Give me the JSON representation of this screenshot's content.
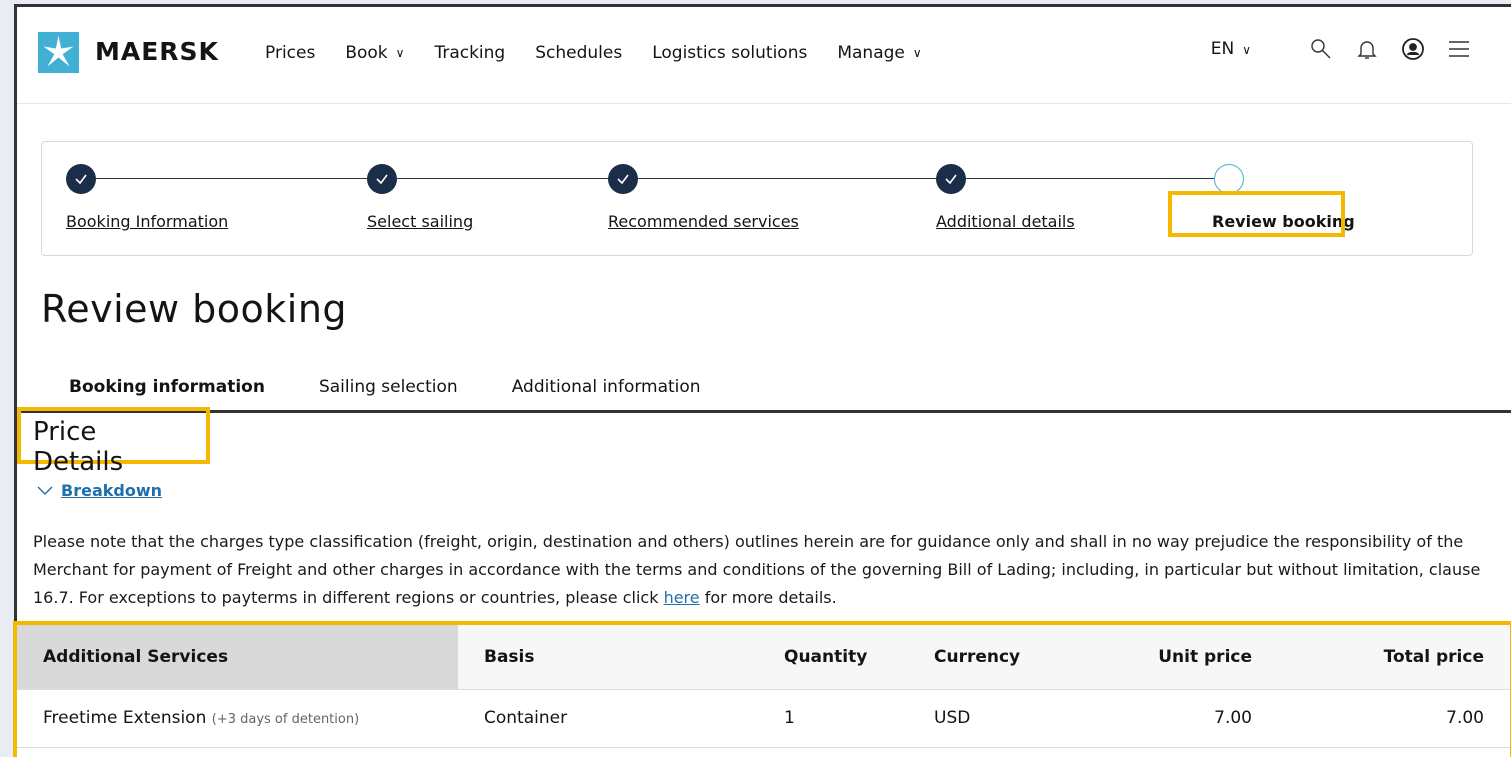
{
  "header": {
    "brand": "MAERSK",
    "nav": [
      {
        "label": "Prices",
        "has_menu": false
      },
      {
        "label": "Book",
        "has_menu": true
      },
      {
        "label": "Tracking",
        "has_menu": false
      },
      {
        "label": "Schedules",
        "has_menu": false
      },
      {
        "label": "Logistics solutions",
        "has_menu": false
      },
      {
        "label": "Manage",
        "has_menu": true
      }
    ],
    "language": "EN",
    "icons": [
      "search-icon",
      "bell-icon",
      "user-icon",
      "hamburger-menu-icon"
    ]
  },
  "stepper": {
    "steps": [
      {
        "label": "Booking Information",
        "done": true
      },
      {
        "label": "Select sailing",
        "done": true
      },
      {
        "label": "Recommended services",
        "done": true
      },
      {
        "label": "Additional details",
        "done": true
      },
      {
        "label": "Review booking",
        "done": false
      }
    ]
  },
  "page_title": "Review booking",
  "tabs": [
    {
      "label": "Booking information",
      "active": true
    },
    {
      "label": "Sailing selection",
      "active": false
    },
    {
      "label": "Additional information",
      "active": false
    }
  ],
  "price": {
    "title": "Price Details",
    "breakdown_label": "Breakdown",
    "note_text": "Please note that the charges type classification (freight, origin, destination and others) outlines herein are for guidance only and shall in no way prejudice the responsibility of the Merchant for payment of Freight and other charges in accordance with the terms and conditions of the governing Bill of Lading; including, in particular but without limitation, clause 16.7. For exceptions to payterms in different regions or countries, please click",
    "note_link": "here",
    "note_tail": "for more details.",
    "table": {
      "headers": [
        "Additional Services",
        "Basis",
        "Quantity",
        "Currency",
        "Unit price",
        "Total price"
      ],
      "rows": [
        {
          "service": "Freetime Extension",
          "service_note": "(+3 days of detention)",
          "basis": "Container",
          "quantity": "1",
          "currency": "USD",
          "unit_price": "7.00",
          "total_price": "7.00"
        }
      ]
    }
  },
  "colors": {
    "accent": "#42b0d5",
    "highlight": "#f5b800",
    "step_done": "#1a2e4a",
    "link": "#1f6fad"
  }
}
